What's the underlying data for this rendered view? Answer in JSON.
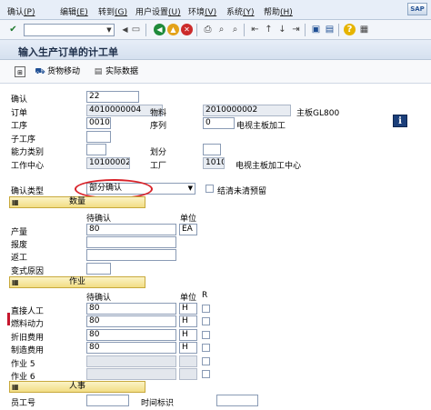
{
  "menu": [
    {
      "text": "确认",
      "key": "(P)"
    },
    {
      "text": "编辑",
      "key": "(E)"
    },
    {
      "text": "转到",
      "key": "(G)"
    },
    {
      "text": "用户设置",
      "key": "(U)"
    },
    {
      "text": "环境",
      "key": "(V)"
    },
    {
      "text": "系统",
      "key": "(Y)"
    },
    {
      "text": "帮助",
      "key": "(H)"
    }
  ],
  "window_title": "输入生产订单的计工单",
  "app_toolbar": {
    "goods_movement": "货物移动",
    "actual_data": "实际数据"
  },
  "form": {
    "confirm_label": "确认",
    "confirm_value": "22",
    "order_label": "订单",
    "order_value": "4010000004",
    "material_label": "物料",
    "material_value": "2010000002",
    "material_desc": "主板GL800",
    "operation_label": "工序",
    "operation_value": "0010",
    "sequence_label": "序列",
    "sequence_value": "0",
    "operation_desc": "电视主板加工",
    "suboperation_label": "子工序",
    "capacity_label": "能力类别",
    "split_label": "划分",
    "workcenter_label": "工作中心",
    "workcenter_value": "10100002",
    "plant_label": "工厂",
    "plant_value": "1010",
    "workcenter_desc": "电视主板加工中心",
    "confirm_type_label": "确认类型",
    "confirm_type_value": "部分确认",
    "clear_reservation_label": "结清未清预留"
  },
  "quantity": {
    "group_label": "数量",
    "col_to_confirm": "待确认",
    "col_unit": "单位",
    "rows": [
      {
        "label": "产量",
        "value": "80",
        "unit": "EA"
      },
      {
        "label": "报废",
        "value": "",
        "unit": ""
      },
      {
        "label": "返工",
        "value": "",
        "unit": ""
      },
      {
        "label": "变式原因",
        "value": "",
        "unit": ""
      }
    ]
  },
  "activities": {
    "group_label": "作业",
    "col_to_confirm": "待确认",
    "col_unit": "单位",
    "col_r": "R",
    "rows": [
      {
        "label": "直接人工",
        "value": "80",
        "unit": "H"
      },
      {
        "label": "燃料动力",
        "value": "80",
        "unit": "H"
      },
      {
        "label": "折旧费用",
        "value": "80",
        "unit": "H"
      },
      {
        "label": "制造费用",
        "value": "80",
        "unit": "H"
      },
      {
        "label": "作业 5",
        "value": "",
        "unit": ""
      },
      {
        "label": "作业 6",
        "value": "",
        "unit": ""
      }
    ]
  },
  "personnel": {
    "group_label": "人事",
    "employee_label": "员工号",
    "time_id_label": "时间标识"
  },
  "icons": {
    "check": "check-icon",
    "back": "back-icon",
    "exit": "exit-icon",
    "cancel": "cancel-icon",
    "print": "print-icon",
    "find": "find-icon",
    "info": "info-icon"
  }
}
